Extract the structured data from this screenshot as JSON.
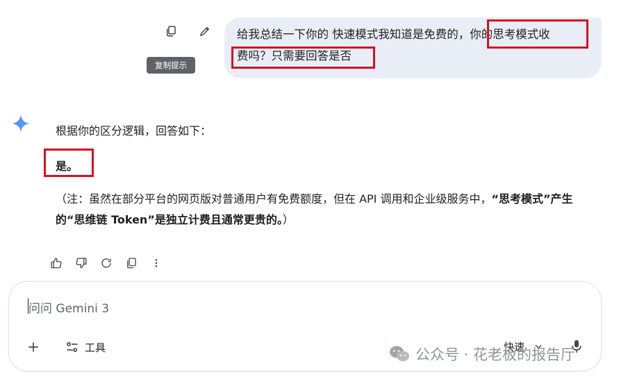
{
  "user_message": {
    "part1": "给我总结一下你的 快速模式我知道是免费的，",
    "part2_highlighted": "你的思考模式收",
    "part3_highlighted": "费吗？只需要回答是否"
  },
  "message_actions": {
    "copy_tooltip": "复制提示"
  },
  "response": {
    "intro": "根据你的区分逻辑，回答如下：",
    "answer": "是。",
    "note_plain": "（注：虽然在部分平台的网页版对普通用户有免费额度，但在 API 调用和企业级服务中，",
    "note_bold": "“思考模式”产生的“思维链 Token”是独立计费且通常更贵的。",
    "note_end": "）"
  },
  "input": {
    "placeholder": "问问 Gemini 3",
    "tools_label": "工具",
    "mode_label": "快速"
  },
  "watermark": {
    "text": "公众号 · 花老板的报告厅"
  },
  "colors": {
    "highlight_red": "#d3121f",
    "user_bubble_bg": "#e9eef6",
    "tooltip_bg": "#5f6368",
    "gemini_blue": "#4285f4"
  }
}
